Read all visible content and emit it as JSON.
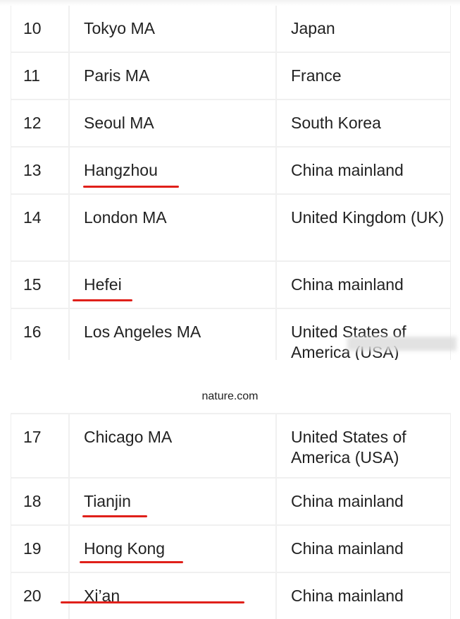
{
  "table_top": [
    {
      "rank": "10",
      "city": "Tokyo MA",
      "country": "Japan",
      "highlighted": false
    },
    {
      "rank": "11",
      "city": "Paris MA",
      "country": "France",
      "highlighted": false
    },
    {
      "rank": "12",
      "city": "Seoul MA",
      "country": "South Korea",
      "highlighted": false
    },
    {
      "rank": "13",
      "city": "Hangzhou",
      "country": "China mainland",
      "highlighted": true
    },
    {
      "rank": "14",
      "city": "London MA",
      "country": "United Kingdom (UK)",
      "highlighted": false
    },
    {
      "rank": "15",
      "city": "Hefei",
      "country": "China mainland",
      "highlighted": true
    },
    {
      "rank": "16",
      "city": "Los Angeles MA",
      "country": "United States of America (USA)",
      "highlighted": false
    }
  ],
  "source": "nature.com",
  "table_bottom": [
    {
      "rank": "17",
      "city": "Chicago MA",
      "country": "United States of America (USA)",
      "highlighted": false
    },
    {
      "rank": "18",
      "city": "Tianjin",
      "country": "China mainland",
      "highlighted": true
    },
    {
      "rank": "19",
      "city": "Hong Kong",
      "country": "China mainland",
      "highlighted": true
    },
    {
      "rank": "20",
      "city": "Xi’an",
      "country": "China mainland",
      "highlighted": true
    }
  ],
  "colors": {
    "underline": "#e0201a"
  }
}
